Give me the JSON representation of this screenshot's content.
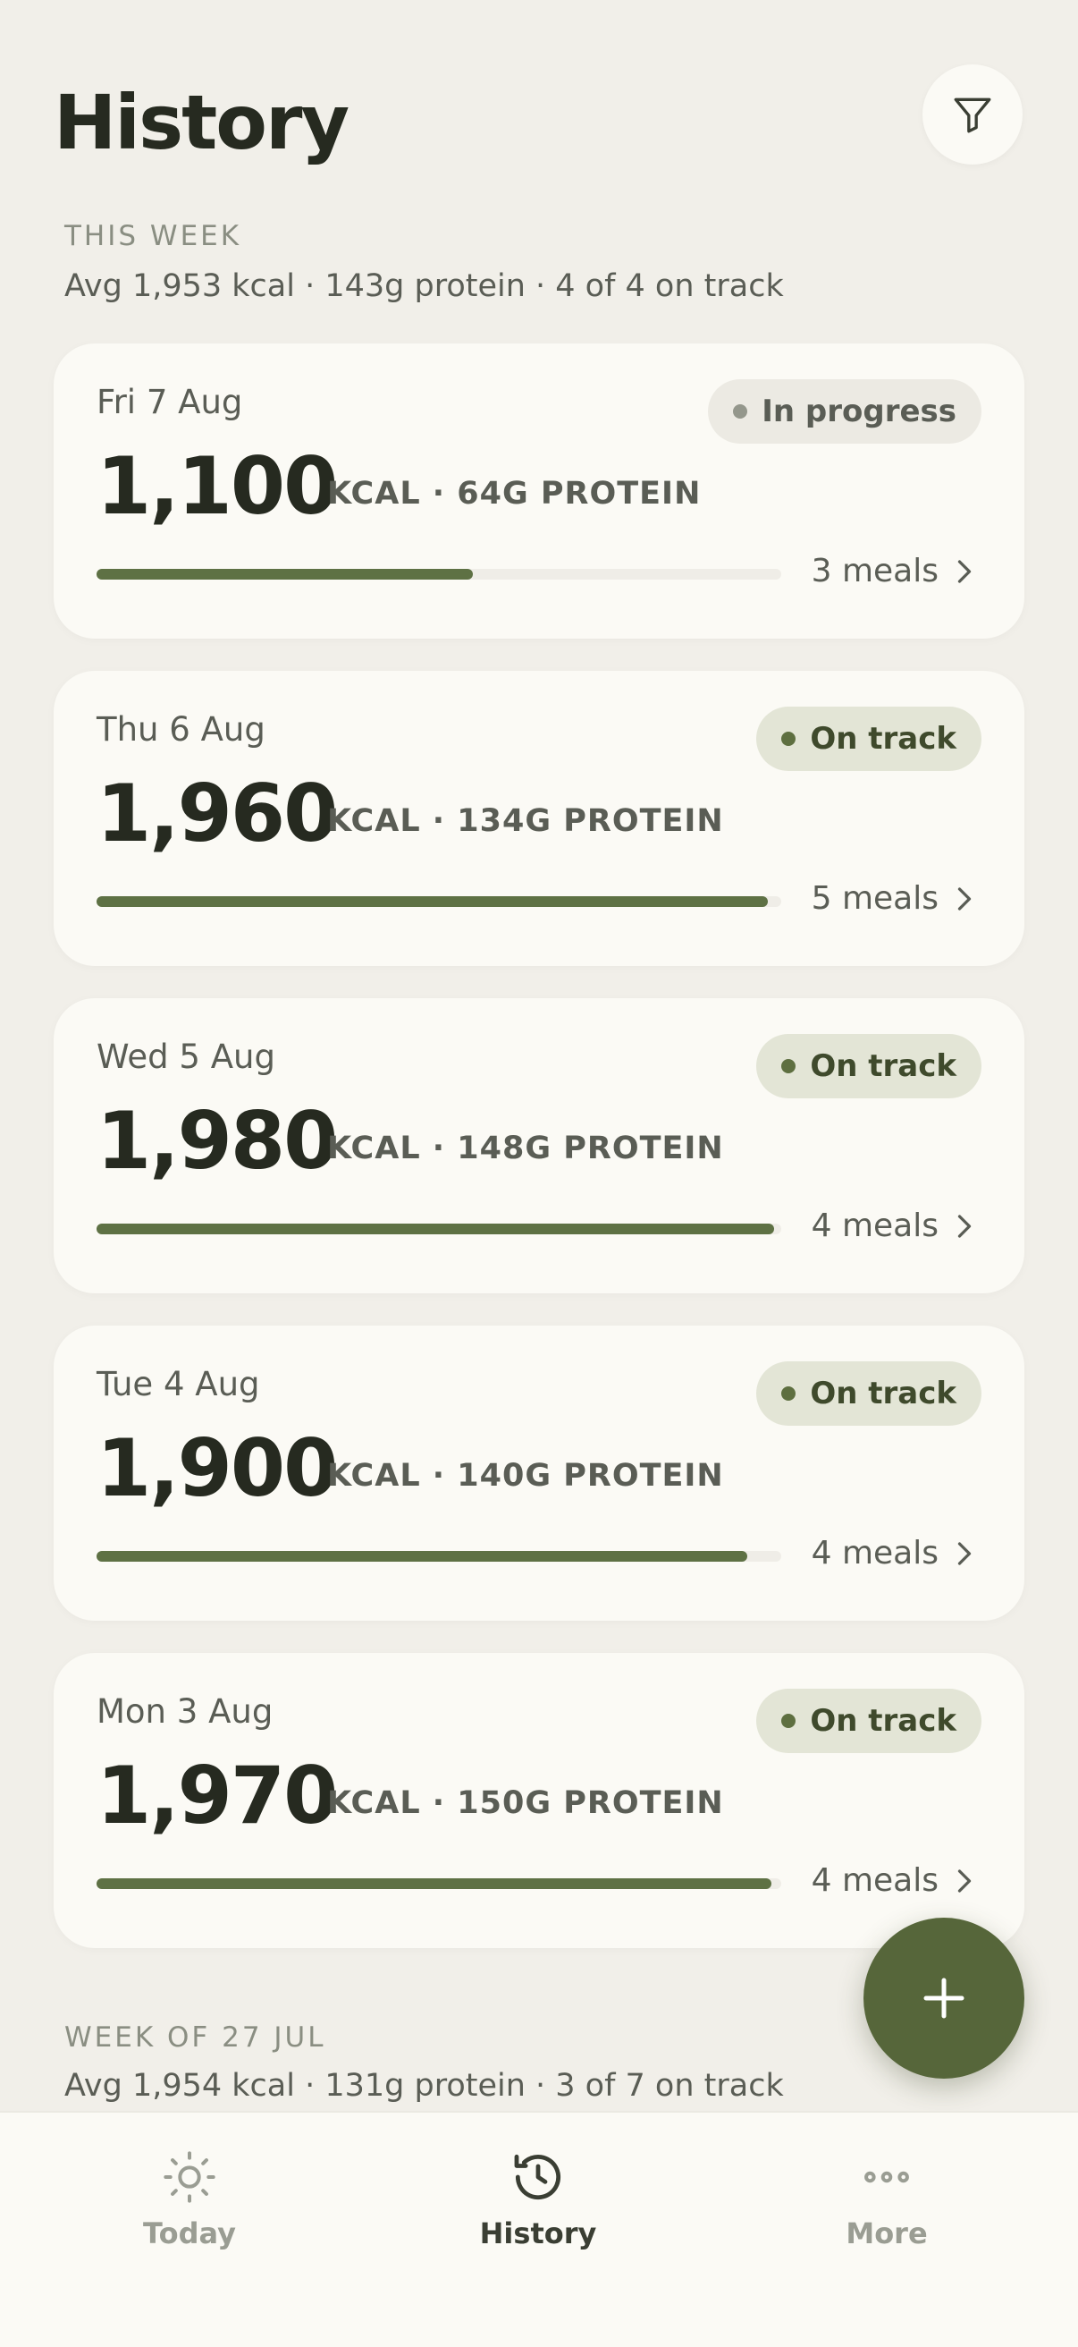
{
  "header": {
    "title": "History"
  },
  "sections": [
    {
      "label": "THIS WEEK",
      "summary": "Avg 1,953 kcal · 143g protein · 4 of 4 on track"
    },
    {
      "label": "WEEK OF 27 JUL",
      "summary": "Avg 1,954 kcal · 131g protein · 3 of 7 on track"
    }
  ],
  "days": [
    {
      "date": "Fri 7 Aug",
      "status": "In progress",
      "kcal": "1,100",
      "detail": "KCAL · 64G PROTEIN",
      "meals": "3 meals",
      "progress": 0.55
    },
    {
      "date": "Thu 6 Aug",
      "status": "On track",
      "kcal": "1,960",
      "detail": "KCAL · 134G PROTEIN",
      "meals": "5 meals",
      "progress": 0.98
    },
    {
      "date": "Wed 5 Aug",
      "status": "On track",
      "kcal": "1,980",
      "detail": "KCAL · 148G PROTEIN",
      "meals": "4 meals",
      "progress": 0.99
    },
    {
      "date": "Tue 4 Aug",
      "status": "On track",
      "kcal": "1,900",
      "detail": "KCAL · 140G PROTEIN",
      "meals": "4 meals",
      "progress": 0.95
    },
    {
      "date": "Mon 3 Aug",
      "status": "On track",
      "kcal": "1,970",
      "detail": "KCAL · 150G PROTEIN",
      "meals": "4 meals",
      "progress": 0.985
    }
  ],
  "nav": [
    {
      "label": "Today",
      "icon": "sun-icon",
      "active": false
    },
    {
      "label": "History",
      "icon": "history-icon",
      "active": true
    },
    {
      "label": "More",
      "icon": "more-icon",
      "active": false
    }
  ],
  "fab": {
    "icon": "plus-icon"
  },
  "colors": {
    "accent": "#56663A",
    "background": "#F1EFE9",
    "card": "#FBFAF5"
  }
}
